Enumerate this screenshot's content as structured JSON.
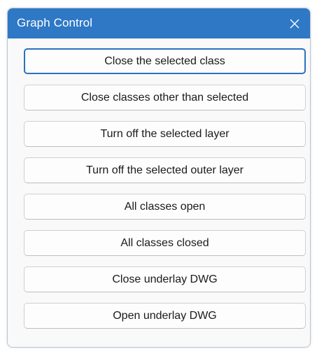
{
  "window": {
    "title": "Graph Control",
    "title_bar_color": "#2e78c6",
    "close_icon": "close-x-icon"
  },
  "buttons": [
    {
      "label": "Close the selected class",
      "focused": true
    },
    {
      "label": "Close classes other than selected",
      "focused": false
    },
    {
      "label": "Turn off the selected layer",
      "focused": false
    },
    {
      "label": "Turn off the selected outer layer",
      "focused": false
    },
    {
      "label": "All classes open",
      "focused": false
    },
    {
      "label": "All classes closed",
      "focused": false
    },
    {
      "label": "Close underlay DWG",
      "focused": false
    },
    {
      "label": "Open underlay DWG",
      "focused": false
    }
  ]
}
